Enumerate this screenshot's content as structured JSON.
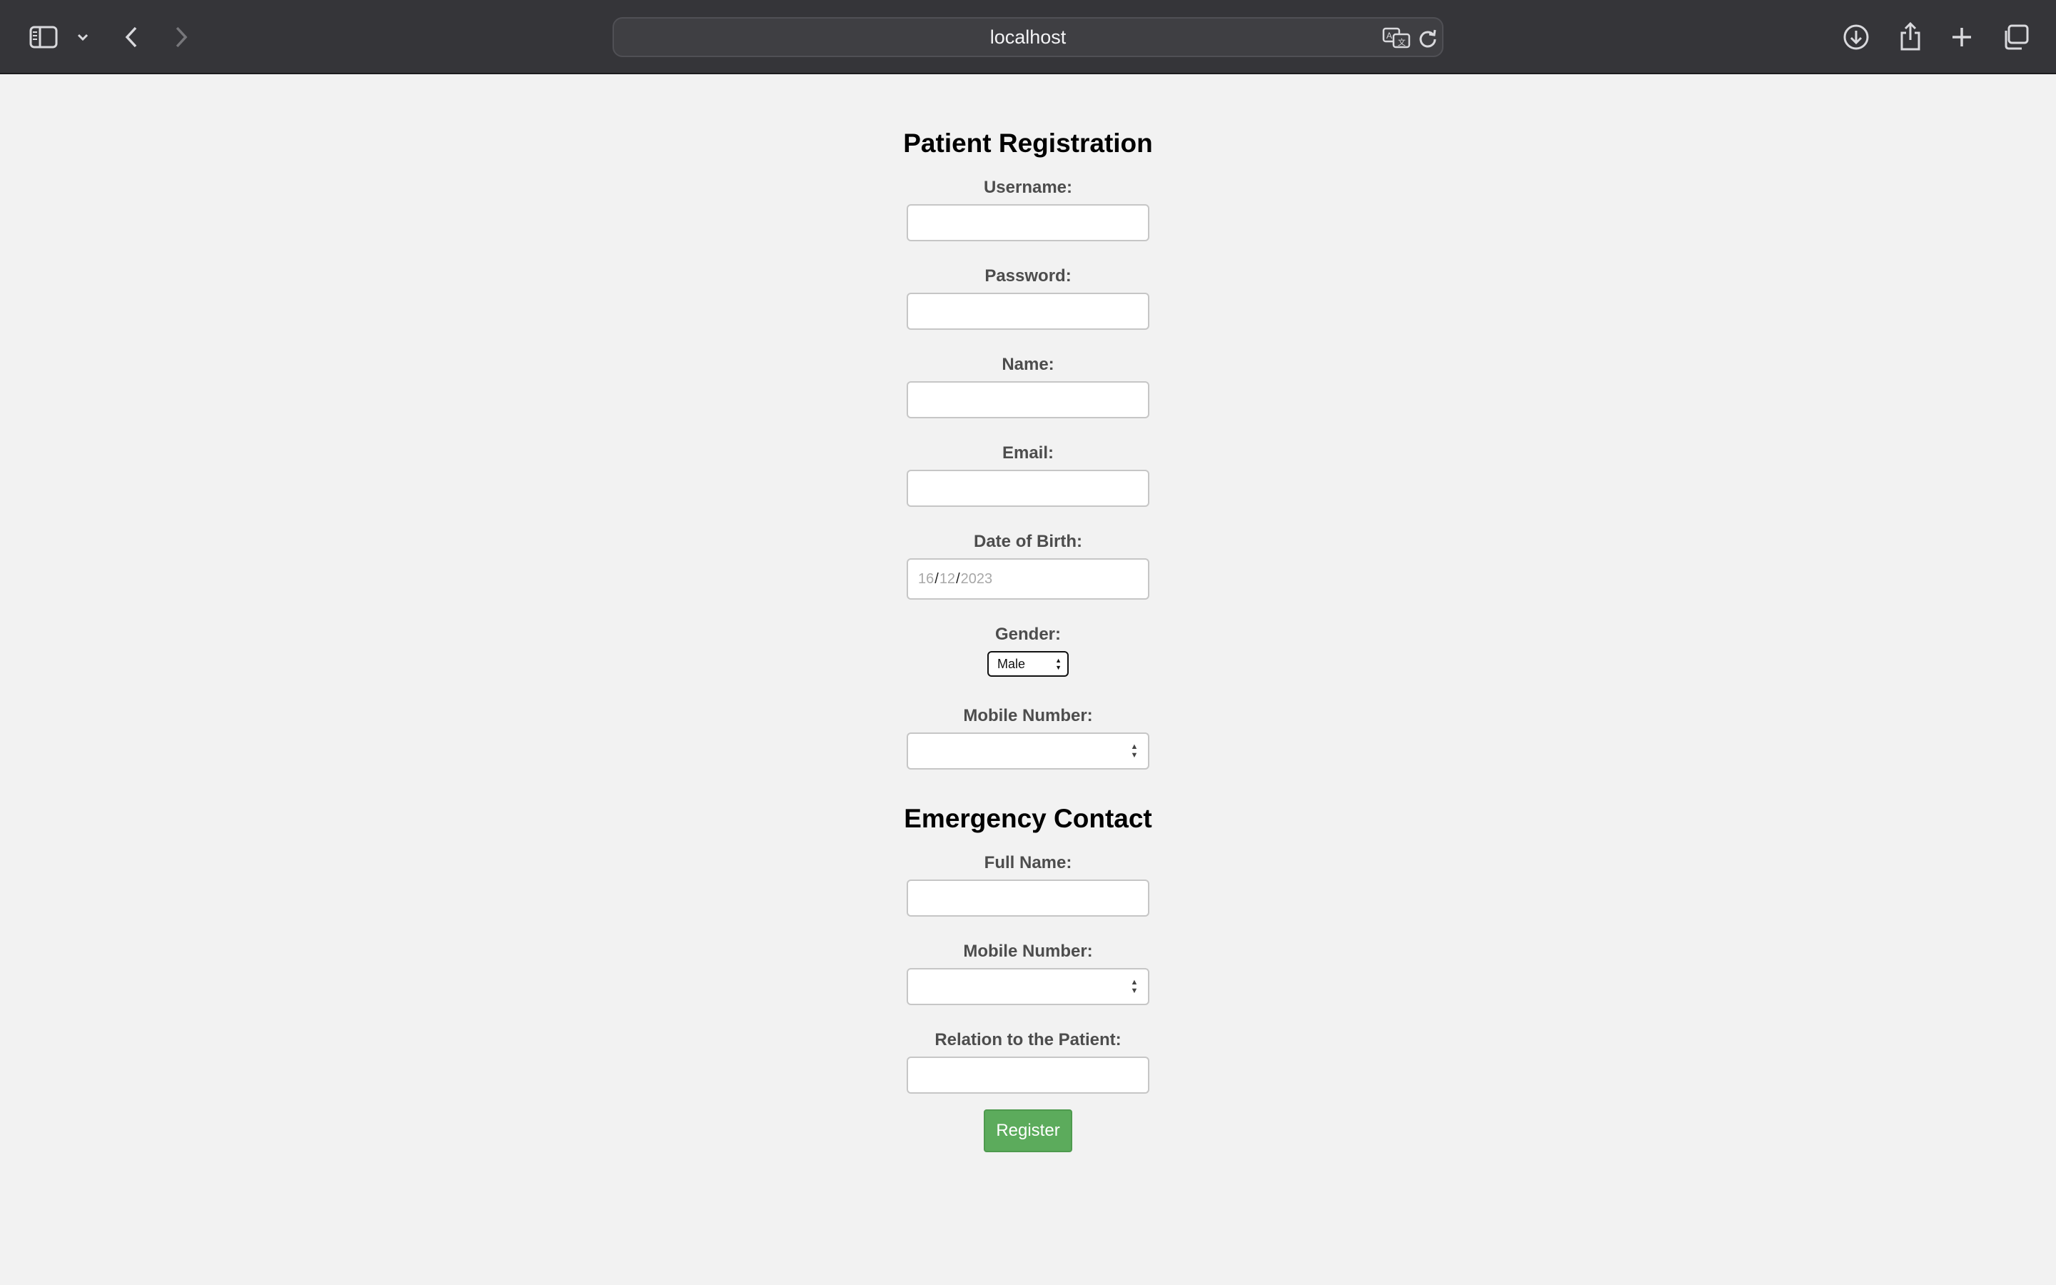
{
  "browser": {
    "address": "localhost",
    "icons": {
      "sidebar": "sidebar-icon",
      "sidebar_menu": "chevron-down-icon",
      "back": "back-icon",
      "forward": "forward-icon",
      "translate": "translate-icon",
      "reload": "reload-icon",
      "downloads": "download-icon",
      "share": "share-icon",
      "new_tab": "plus-icon",
      "tabs": "tabs-icon"
    }
  },
  "form": {
    "title": "Patient Registration",
    "username_label": "Username:",
    "password_label": "Password:",
    "name_label": "Name:",
    "email_label": "Email:",
    "dob_label": "Date of Birth:",
    "dob": {
      "day": "16",
      "month": "12",
      "year": "2023",
      "separator": "/"
    },
    "gender_label": "Gender:",
    "gender_value": "Male",
    "mobile_label": "Mobile Number:"
  },
  "emergency": {
    "title": "Emergency Contact",
    "full_name_label": "Full Name:",
    "mobile_label": "Mobile Number:",
    "relation_label": "Relation to the Patient:"
  },
  "actions": {
    "register_label": "Register"
  },
  "colors": {
    "register_button": "#5cab5c",
    "toolbar": "#353539",
    "page_background": "#f2f2f2"
  }
}
